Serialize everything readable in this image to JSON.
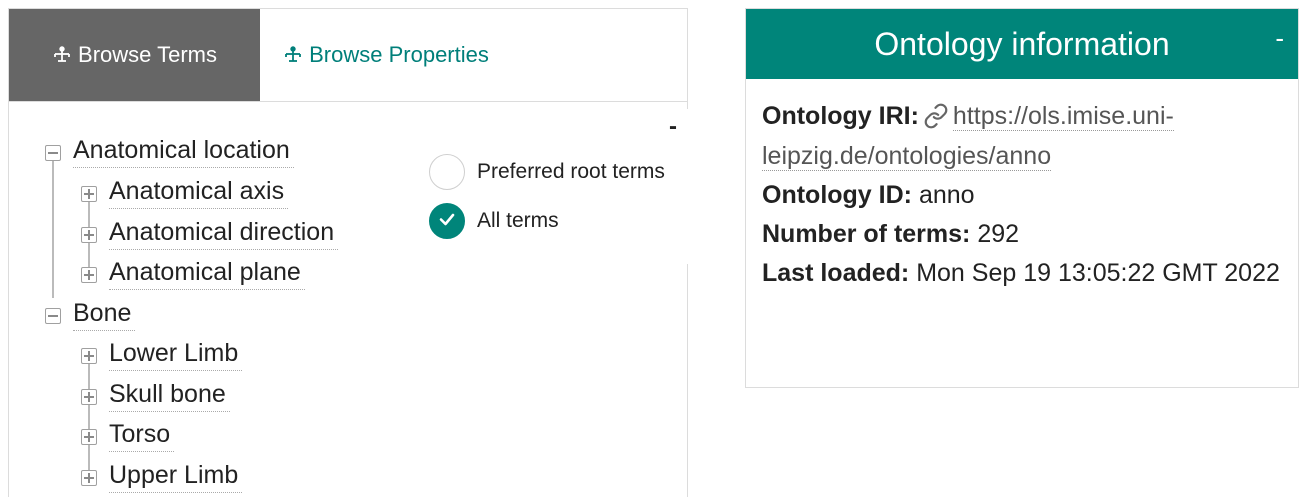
{
  "tabs": {
    "browse_terms": "Browse Terms",
    "browse_properties": "Browse Properties"
  },
  "tree": {
    "roots": [
      {
        "label": "Anatomical location",
        "children": [
          "Anatomical axis",
          "Anatomical direction",
          "Anatomical plane"
        ]
      },
      {
        "label": "Bone",
        "children": [
          "Lower Limb",
          "Skull bone",
          "Torso",
          "Upper Limb"
        ]
      }
    ]
  },
  "root_selector": {
    "collapse": "-",
    "options": [
      {
        "label": "Preferred root terms",
        "checked": false
      },
      {
        "label": "All terms",
        "checked": true
      }
    ]
  },
  "info": {
    "title": "Ontology information",
    "collapse": "-",
    "iri_label": "Ontology IRI:",
    "iri_value": "https://ols.imise.uni-leipzig.de/ontologies/anno",
    "id_label": "Ontology ID:",
    "id_value": "anno",
    "terms_label": "Number of terms:",
    "terms_value": "292",
    "loaded_label": "Last loaded:",
    "loaded_value": "Mon Sep 19 13:05:22 GMT 2022"
  },
  "colors": {
    "accent": "#00857a",
    "tab_active_bg": "#666666"
  },
  "icons": [
    "sitemap-icon",
    "link-icon",
    "check-icon"
  ]
}
